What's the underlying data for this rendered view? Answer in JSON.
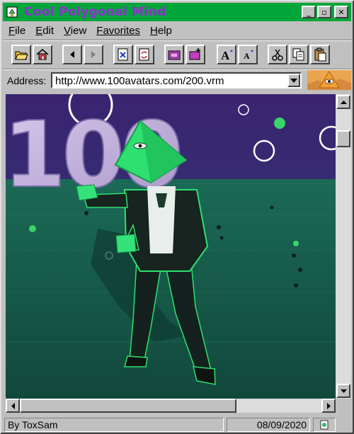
{
  "window": {
    "title": "Cool Polygonal Mind"
  },
  "title_buttons": {
    "minimize": "_",
    "maximize": "▫",
    "close": "✕"
  },
  "menu": [
    {
      "key": "F",
      "rest": "ile"
    },
    {
      "key": "E",
      "rest": "dit"
    },
    {
      "key": "V",
      "rest": "iew"
    },
    {
      "key": "",
      "rest": "Favorites"
    },
    {
      "key": "H",
      "rest": "elp"
    }
  ],
  "address": {
    "label": "Address:",
    "url": "http://www.100avatars.com/200.vrm"
  },
  "content": {
    "scene_text": "100"
  },
  "status": {
    "author": "By ToxSam",
    "date": "08/09/2020"
  },
  "colors": {
    "titlebar": "#00a63a",
    "title_text": "#9a2ad8",
    "avatar_green": "#2ee06f"
  }
}
